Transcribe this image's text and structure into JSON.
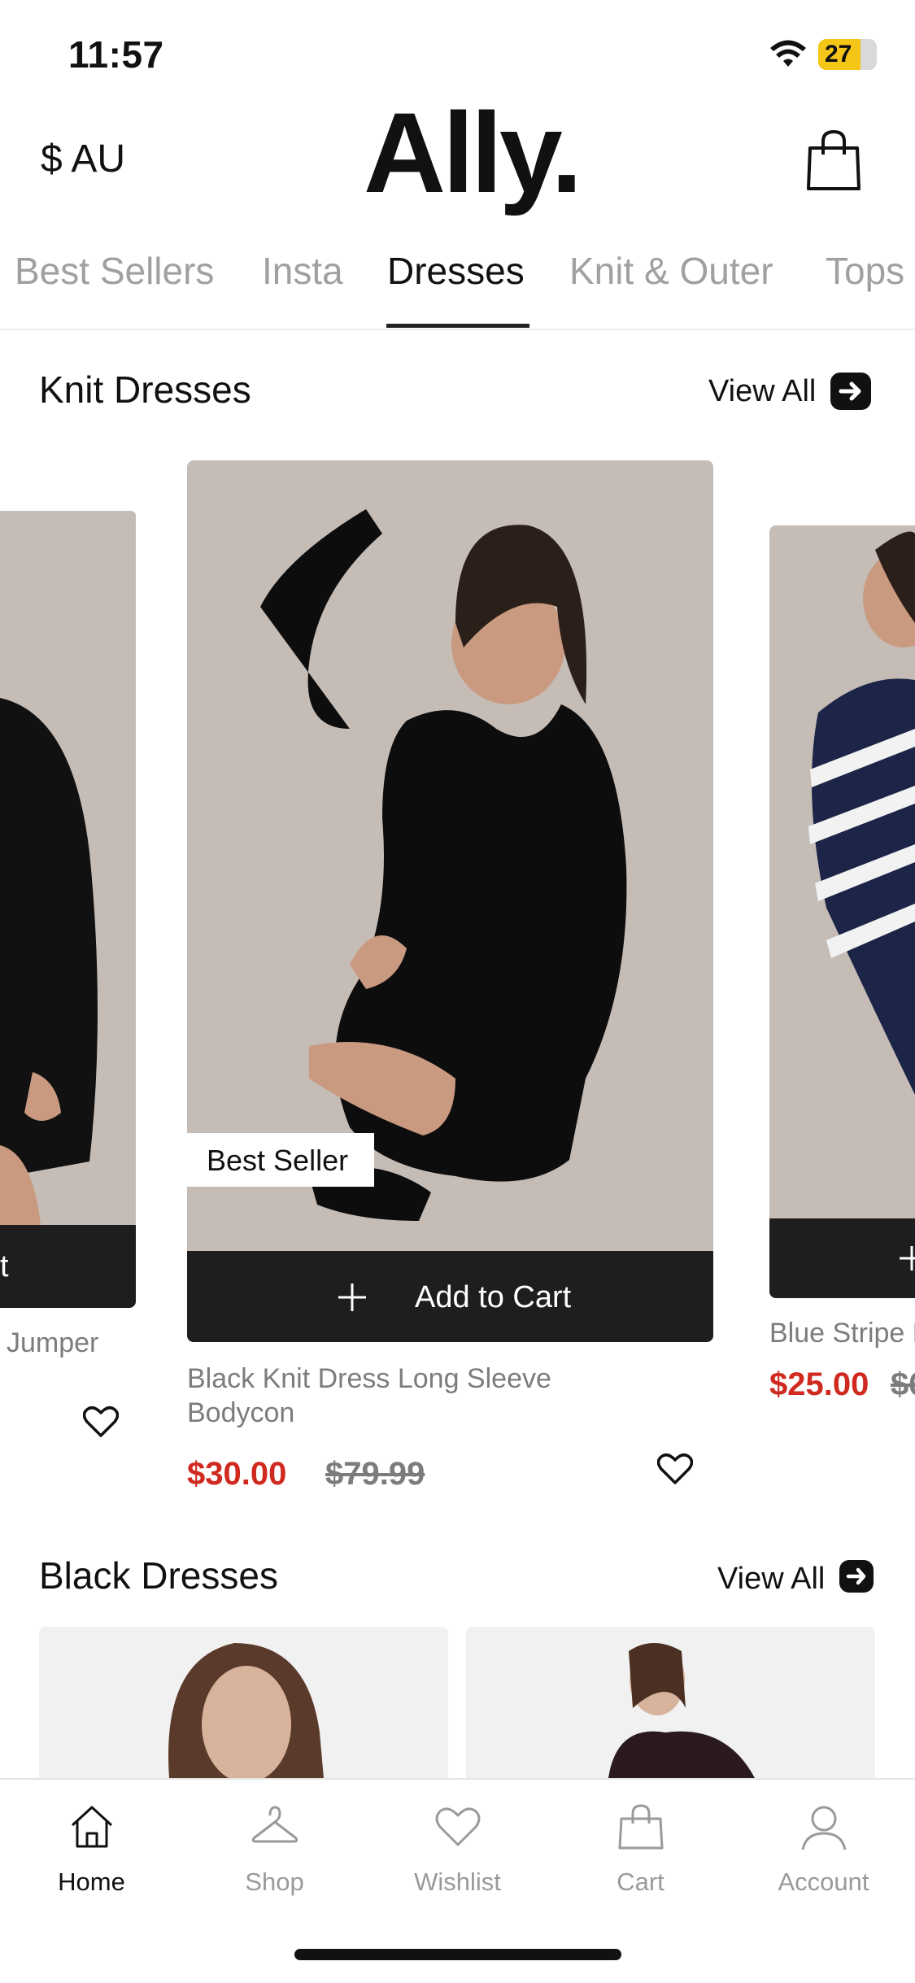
{
  "status": {
    "time": "11:57",
    "battery": "27"
  },
  "header": {
    "currency": "$ AU",
    "logo": "Ally."
  },
  "tabs": [
    {
      "label": "Best Sellers",
      "active": false
    },
    {
      "label": "Insta",
      "active": false
    },
    {
      "label": "Dresses",
      "active": true
    },
    {
      "label": "Knit & Outer",
      "active": false
    },
    {
      "label": "Tops",
      "active": false
    }
  ],
  "knit_section": {
    "title": "Knit Dresses",
    "view_all": "View All",
    "left_product": {
      "name": "Jumper",
      "cart_label": "t"
    },
    "center_product": {
      "badge": "Best Seller",
      "cart_label": "Add to Cart",
      "name_line1": "Black Knit Dress Long Sleeve",
      "name_line2": "Bodycon",
      "price": "$30.00",
      "old_price": "$79.99"
    },
    "right_product": {
      "name": "Blue Stripe K",
      "price": "$25.00",
      "old_price": "$6"
    }
  },
  "black_section": {
    "title": "Black Dresses",
    "view_all": "View All"
  },
  "bottom_nav": [
    {
      "label": "Home",
      "icon": "home-icon",
      "active": true
    },
    {
      "label": "Shop",
      "icon": "hanger-icon",
      "active": false
    },
    {
      "label": "Wishlist",
      "icon": "heart-icon",
      "active": false
    },
    {
      "label": "Cart",
      "icon": "bag-icon",
      "active": false
    },
    {
      "label": "Account",
      "icon": "user-icon",
      "active": false
    }
  ],
  "colors": {
    "sale_price": "#d0291f",
    "cart_bar": "#1e1e1f",
    "photo_bg": "#c5bcb6"
  }
}
